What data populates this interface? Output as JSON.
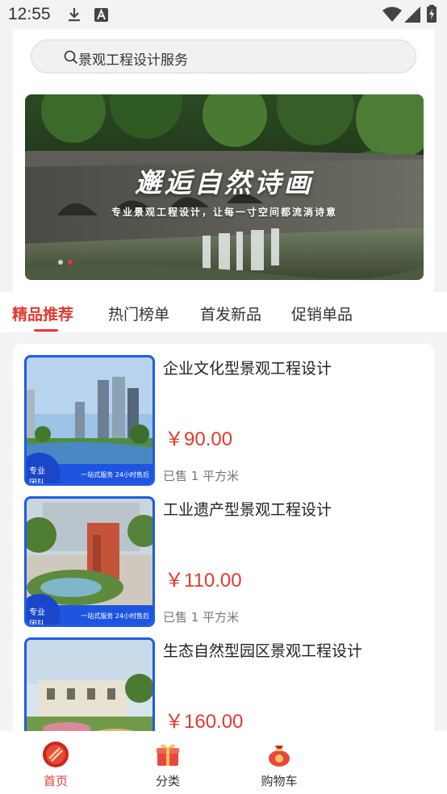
{
  "status_bar": {
    "time": "12:55"
  },
  "search": {
    "text": "景观工程设计服务"
  },
  "banner": {
    "title": "邂逅自然诗画",
    "subtitle": "专业景观工程设计，让每一寸空间都流淌诗意"
  },
  "tabs": [
    {
      "label": "精品推荐",
      "active": true
    },
    {
      "label": "热门榜单"
    },
    {
      "label": "首发新品"
    },
    {
      "label": "促销单品"
    }
  ],
  "products": [
    {
      "title": "企业文化型景观工程设计",
      "price": "￥90.00",
      "sold": "已售 1 平方米",
      "badge": "专业团队",
      "footer": "一站式服务 24小时售后"
    },
    {
      "title": "工业遗产型景观工程设计",
      "price": "￥110.00",
      "sold": "已售 1 平方米",
      "badge": "专业团队",
      "footer": "一站式服务 24小时售后"
    },
    {
      "title": "生态自然型园区景观工程设计",
      "price": "￥160.00",
      "sold": "",
      "badge": "",
      "footer": ""
    }
  ],
  "bottom_nav": [
    {
      "label": "首页",
      "icon": "home-icon",
      "active": true
    },
    {
      "label": "分类",
      "icon": "gift-category-icon"
    },
    {
      "label": "购物车",
      "icon": "money-bag-cart-icon"
    }
  ],
  "colors": {
    "accent": "#e33a2f",
    "badge_blue": "#1f5be8",
    "background": "#f3f3f3"
  }
}
